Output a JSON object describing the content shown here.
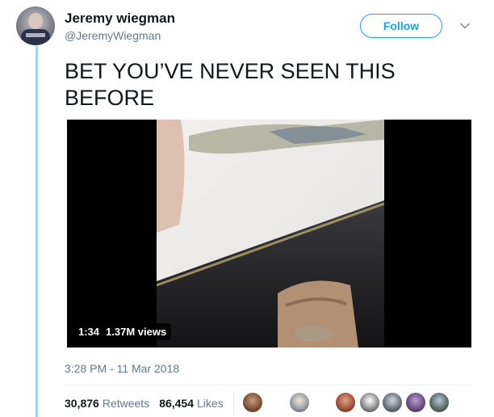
{
  "tweet": {
    "author": {
      "display_name": "Jeremy wiegman",
      "handle": "@JeremyWiegman"
    },
    "follow_label": "Follow",
    "text": "BET YOU’VE NEVER SEEN THIS\nBEFORE",
    "video": {
      "duration": "1:34",
      "views": "1.37M views"
    },
    "timestamp": "3:28 PM - 11 Mar 2018",
    "stats": {
      "retweets_count": "30,876",
      "retweets_label": "Retweets",
      "likes_count": "86,454",
      "likes_label": "Likes"
    },
    "liker_avatars": [
      "liker-1",
      "liker-2",
      "liker-3",
      "liker-4",
      "liker-5",
      "liker-6",
      "liker-7"
    ]
  },
  "icons": {
    "caret": "chevron-down-icon"
  },
  "colors": {
    "accent": "#1da1f2",
    "thread_line": "#a6d4f0",
    "secondary_text": "#657786",
    "primary_text": "#14171a"
  }
}
